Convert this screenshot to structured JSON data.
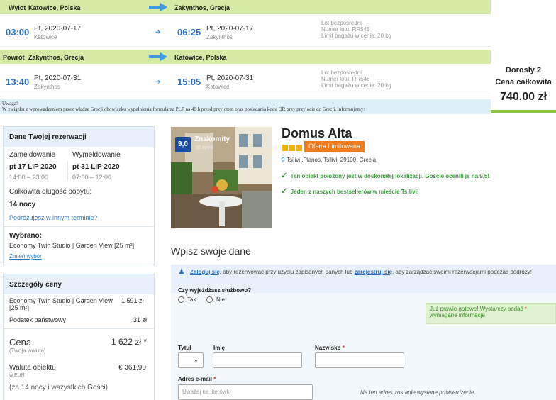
{
  "outbound": {
    "header_label": "Wylot",
    "from": "Katowice, Polska",
    "to": "Zakynthos, Grecja",
    "dep_time": "03:00",
    "dep_date": "Pt, 2020-07-17",
    "dep_city": "Katowice",
    "arr_time": "06:25",
    "arr_date": "Pt, 2020-07-17",
    "arr_city": "Zakynthos",
    "info1": "Lot bezpośredni",
    "info2": "Numer lotu: RR545",
    "info3": "Limit bagażu w cenie: 20 kg"
  },
  "return": {
    "header_label": "Powrót",
    "from": "Zakynthos, Grecja",
    "to": "Katowice, Polska",
    "dep_time": "13:40",
    "dep_date": "Pt, 2020-07-31",
    "dep_city": "Zakynthos",
    "arr_time": "15:05",
    "arr_date": "Pt, 2020-07-31",
    "arr_city": "Katowice",
    "info1": "Lot bezpośredni",
    "info2": "Numer lotu: RR546",
    "info3": "Limit bagażu w cenie: 20 kg"
  },
  "total": {
    "pax": "Dorosły 2",
    "label": "Cena całkowita",
    "price": "740.00 zł"
  },
  "notice": {
    "title": "Uwaga!",
    "text": "W związku z wprowadzeniem przez władze Grecji obowiązku wypełnienia formularza PLF na 48 h przed przylotem oraz posiadania kodu QR przy przylocie do Grecji, informujemy:"
  },
  "reservation": {
    "heading": "Dane Twojej rezerwacji",
    "checkin_label": "Zameldowanie",
    "checkout_label": "Wymeldowanie",
    "checkin_date": "pt 17 LIP 2020",
    "checkout_date": "pt 31 LIP 2020",
    "checkin_hours": "14:00 – 23:00",
    "checkout_hours": "07:00 – 12:00",
    "stay_label": "Całkowita długość pobytu:",
    "stay_value": "14 nocy",
    "other_dates_link": "Podróżujesz w innym terminie?",
    "chosen_label": "Wybrano:",
    "chosen_value": "Economy Twin Studio | Garden View [25 m²]",
    "change_link": "Zmień wybór"
  },
  "price_details": {
    "heading": "Szczegóły ceny",
    "room_line": "Economy Twin Studio | Garden View [25 m²]",
    "room_price": "1 591 zł",
    "tax_label": "Podatek państwowy",
    "tax_value": "31 zł",
    "price_label": "Cena",
    "price_sub": "(Twoja waluta)",
    "price_value": "1 622 zł *",
    "prop_currency_label": "Waluta obiektu",
    "prop_currency_sub": "w EUR",
    "prop_currency_value": "€ 361,90",
    "footnote": "(za 14 nocy i wszystkich Gości)"
  },
  "hotel": {
    "score": "9,0",
    "score_word": "Znakomity",
    "reviews": "10 opinii",
    "name": "Domus Alta",
    "offer_badge": "Oferta Limitowana",
    "address": "Tsilivi ,Planos, Tsilivi, 29100, Grecja",
    "highlight1": "Ten obiekt położony jest w doskonałej lokalizacji. Goście ocenili ją na 9,5!",
    "highlight2": "Jeden z naszych bestsellerów w mieście Tsilivi!"
  },
  "form": {
    "title": "Wpisz swoje dane",
    "login_link": "Zaloguj się",
    "login_text1": ", aby rezerwować przy użyciu zapisanych danych lub ",
    "register_link": "zarejestruj się",
    "login_text2": ", aby zarządzać swoimi rezerwacjami podczas podróży!",
    "business_q": "Czy wyjeżdżasz służbowo?",
    "yes": "Tak",
    "no": "Nie",
    "tip": "Już prawie gotowe! Wystarczy podać",
    "tip2": "wymagane informacje",
    "title_label": "Tytuł",
    "first_label": "Imię",
    "last_label": "Nazwisko",
    "email_label": "Adres e-mail",
    "email_placeholder": "Uważaj na literówki",
    "email_note": "Na ten adres zostanie wysłane potwierdzenie"
  },
  "colors": {
    "accent_blue": "#2a6fc0",
    "header_green": "#d5eaa5",
    "badge_orange": "#f07b1d",
    "score_blue": "#1a4da1"
  }
}
